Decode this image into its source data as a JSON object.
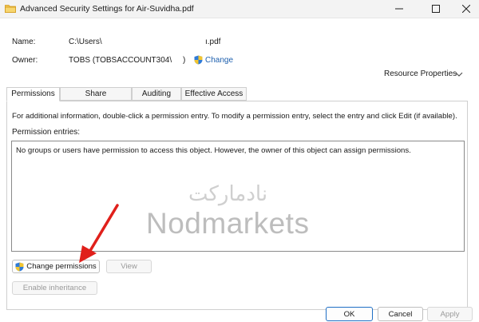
{
  "window": {
    "title": "Advanced Security Settings for Air-Suvidha.pdf",
    "minimize_glyph": "—",
    "maximize_glyph": "☐",
    "close_glyph": "✕"
  },
  "info": {
    "name_label": "Name:",
    "name_value": "C:\\Users\\",
    "name_suffix": "ı.pdf",
    "owner_label": "Owner:",
    "owner_value": "TOBS (TOBSACCOUNT304\\",
    "owner_close": ")",
    "change_link": "Change"
  },
  "resource_properties": "Resource Properties",
  "tabs": [
    {
      "label": "Permissions",
      "active": true
    },
    {
      "label": "Share",
      "active": false
    },
    {
      "label": "Auditing",
      "active": false
    },
    {
      "label": "Effective Access",
      "active": false
    }
  ],
  "permissions": {
    "info_text": "For additional information, double-click a permission entry. To modify a permission entry, select the entry and click Edit (if available).",
    "entries_label": "Permission entries:",
    "empty_message": "No groups or users have permission to access this object. However, the owner of this object can assign permissions.",
    "change_permissions_button": "Change permissions",
    "view_button": "View",
    "enable_inheritance_button": "Enable inheritance"
  },
  "watermark": {
    "arabic": "نادمارکت",
    "latin": "Nodmarkets"
  },
  "footer": {
    "ok": "OK",
    "cancel": "Cancel",
    "apply": "Apply"
  },
  "colors": {
    "link": "#1d5fae",
    "arrow": "#e0201b",
    "ok_border": "#1f6fc5"
  },
  "icons": {
    "title": "folder-icon",
    "change": "uac-shield-icon",
    "resource_properties": "chevron-down-icon",
    "annotation": "red-arrow"
  }
}
